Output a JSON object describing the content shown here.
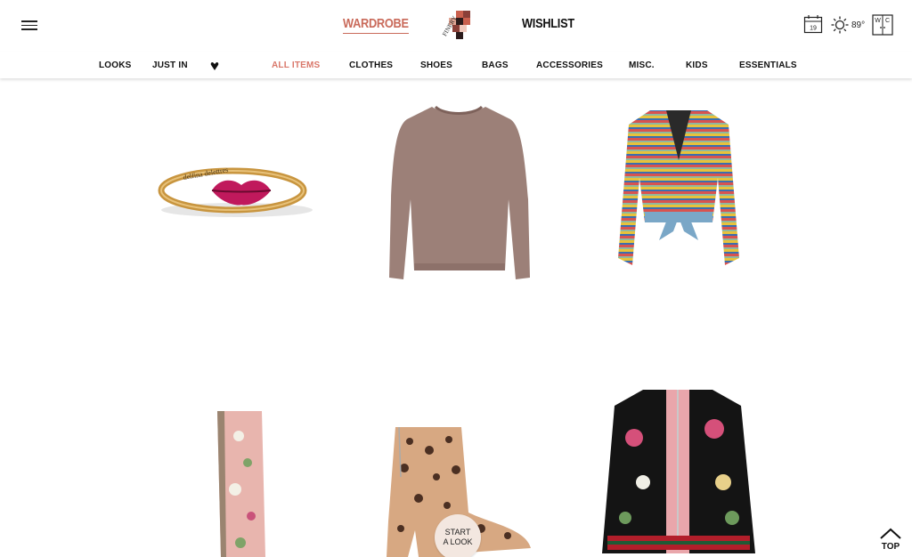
{
  "header": {
    "wardrobe_label": "WARDROBE",
    "wishlist_label": "WISHLIST",
    "logo_text": "FINERY",
    "calendar_day": "19",
    "temperature": "89°",
    "wc_label_top": "W",
    "wc_label_bottom": "C"
  },
  "nav": {
    "looks": "LOOKS",
    "just_in": "JUST IN",
    "all_items": "ALL ITEMS",
    "clothes": "CLOTHES",
    "shoes": "SHOES",
    "bags": "BAGS",
    "accessories": "ACCESSORIES",
    "misc": "MISC.",
    "kids": "KIDS",
    "essentials": "ESSENTIALS"
  },
  "products": {
    "ring_engraving": "delfina delettres"
  },
  "start_look": {
    "line1": "START",
    "line2": "A LOOK"
  },
  "top_label": "TOP",
  "colors": {
    "accent": "#d9776a",
    "wardrobe": "#c96a5a",
    "sweater": "#9c8078",
    "lips": "#c0195c",
    "scarf_pink": "#e8b5ae"
  }
}
